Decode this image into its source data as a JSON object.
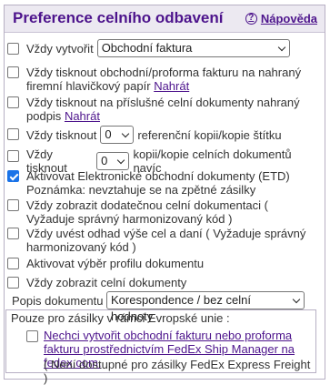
{
  "header": {
    "title": "Preference celního odbavení",
    "help_label": "Nápověda"
  },
  "rows": {
    "always_create": {
      "label": "Vždy vytvořit",
      "selected": "Obchodní faktura"
    },
    "print_invoice": {
      "label": "Vždy tisknout obchodní/proforma fakturu na nahraný firemní hlavičkový papír",
      "link": "Nahrát"
    },
    "print_signature": {
      "label": "Vždy tisknout na příslušné celní dokumenty nahraný podpis",
      "link": "Nahrát"
    },
    "print_reference": {
      "prefix": "Vždy tisknout",
      "value": "0",
      "suffix": "referenční kopii/kopie štítku"
    },
    "print_customs": {
      "prefix": "Vždy tisknout",
      "value": "0",
      "suffix": "kopii/kopie celních dokumentů navíc"
    },
    "etd": {
      "label": "Aktivovat Elektronické obchodní dokumenty (ETD) Poznámka: nevztahuje se na zpětné zásilky"
    },
    "extra_docs": {
      "label": "Vždy zobrazit dodatečnou celní dokumentaci ( Vyžaduje správný harmonizovaný kód )"
    },
    "estimate": {
      "label": "Vždy uvést odhad výše cel a daní ( Vyžaduje správný harmonizovaný kód )"
    },
    "doc_profile": {
      "label": "Aktivovat výběr profilu dokumentu"
    },
    "show_docs": {
      "label": "Vždy zobrazit celní dokumenty"
    },
    "doc_desc": {
      "label": "Popis dokumentu",
      "selected": "Korespondence / bez celní hodnoty"
    }
  },
  "eu": {
    "legend": "Pouze pro zásilky v rámci Evropské unie :",
    "link": "Nechci vytvořit obchodní fakturu nebo proforma fakturu prostřednictvím FedEx Ship Manager na fedex.com.",
    "note": "( Není dostupné pro zásilky FedEx Express Freight )"
  },
  "colors": {
    "accent": "#4d148c",
    "checkbox_checked": "#1a73e8"
  }
}
